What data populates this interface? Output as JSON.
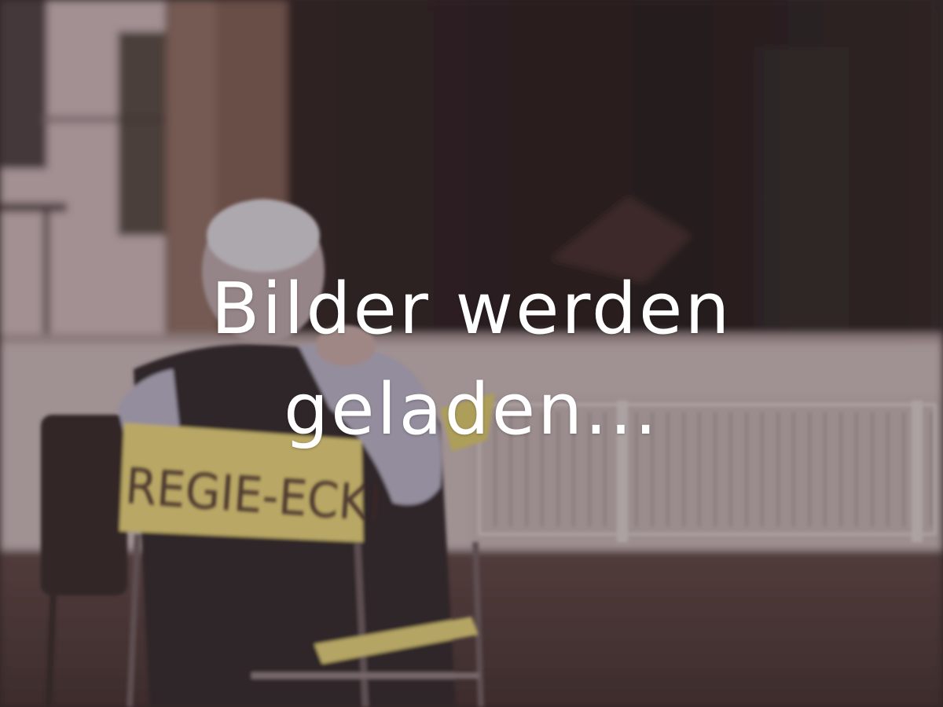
{
  "loading": {
    "line1": "Bilder werden",
    "line2": "geladen..."
  },
  "photo": {
    "sign_text": "REGIE-ECKI"
  },
  "colors": {
    "overlay_text": "#ffffff",
    "sign_yellow": "#e8d373",
    "stage_dark": "#1d1414",
    "wall_pink": "#c7b0b3"
  }
}
